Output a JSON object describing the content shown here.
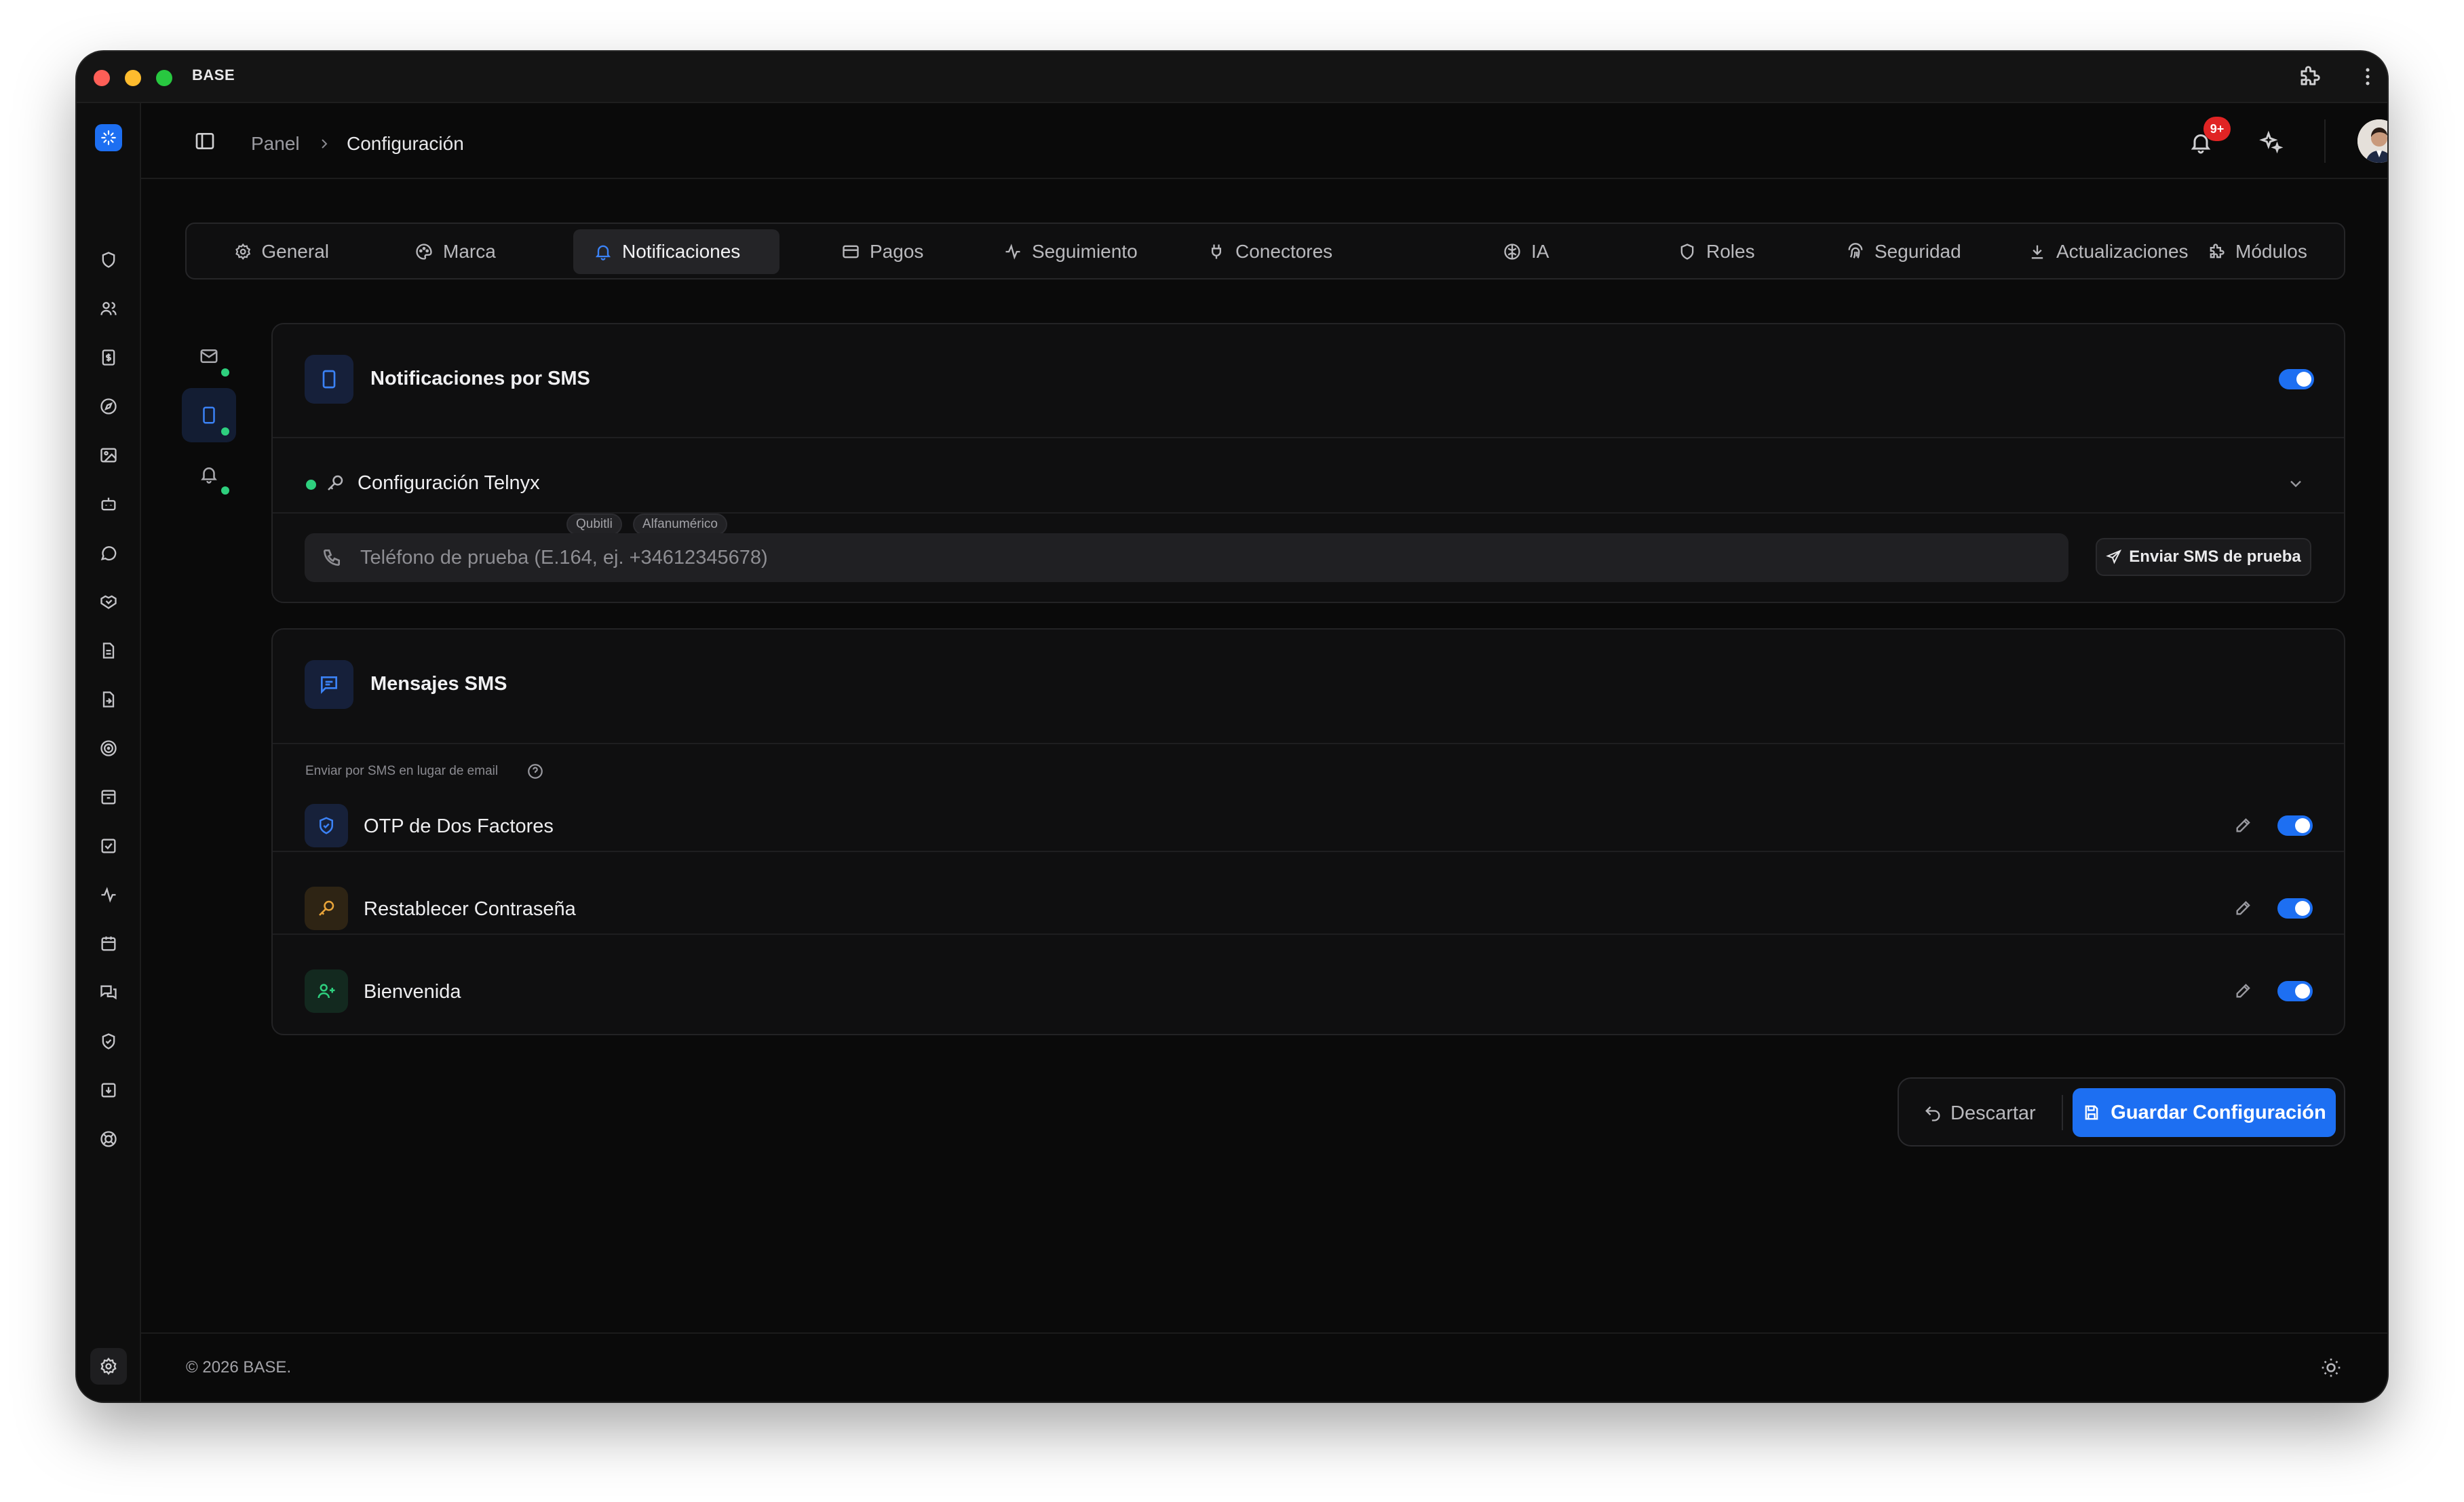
{
  "window": {
    "title": "BASE"
  },
  "breadcrumb": {
    "root": "Panel",
    "current": "Configuración"
  },
  "header": {
    "notif_badge": "9+"
  },
  "tabs": [
    {
      "label": "General",
      "icon": "gear-icon"
    },
    {
      "label": "Marca",
      "icon": "palette-icon"
    },
    {
      "label": "Notificaciones",
      "icon": "bell-icon",
      "active": true
    },
    {
      "label": "Pagos",
      "icon": "card-icon"
    },
    {
      "label": "Seguimiento",
      "icon": "activity-icon"
    },
    {
      "label": "Conectores",
      "icon": "plug-icon"
    },
    {
      "label": "IA",
      "icon": "brain-icon"
    },
    {
      "label": "Roles",
      "icon": "shield-icon"
    },
    {
      "label": "Seguridad",
      "icon": "fingerprint-icon"
    },
    {
      "label": "Actualizaciones",
      "icon": "download-icon"
    },
    {
      "label": "Módulos",
      "icon": "puzzle-icon"
    }
  ],
  "sms_card": {
    "title": "Notificaciones por SMS",
    "enabled": true,
    "provider_label": "Configuración Telnyx",
    "badges": [
      "Qubitli",
      "Alfanumérico"
    ],
    "phone_placeholder": "Teléfono de prueba (E.164, ej. +34612345678)",
    "send_label": "Enviar SMS de prueba"
  },
  "messages_card": {
    "title": "Mensajes SMS",
    "subtitle": "Enviar por SMS en lugar de email",
    "rows": [
      {
        "label": "OTP de Dos Factores",
        "icon": "shield-check-icon",
        "enabled": true
      },
      {
        "label": "Restablecer Contraseña",
        "icon": "key-icon",
        "enabled": true
      },
      {
        "label": "Bienvenida",
        "icon": "user-plus-icon",
        "enabled": true
      }
    ]
  },
  "actions": {
    "discard": "Descartar",
    "save": "Guardar Configuración"
  },
  "footer": {
    "copyright": "© 2026 BASE."
  },
  "colors": {
    "accent": "#1d6ff2",
    "status_green": "#2ecf7e",
    "key_amber": "#e9a53a",
    "background": "#0a0a0a"
  }
}
